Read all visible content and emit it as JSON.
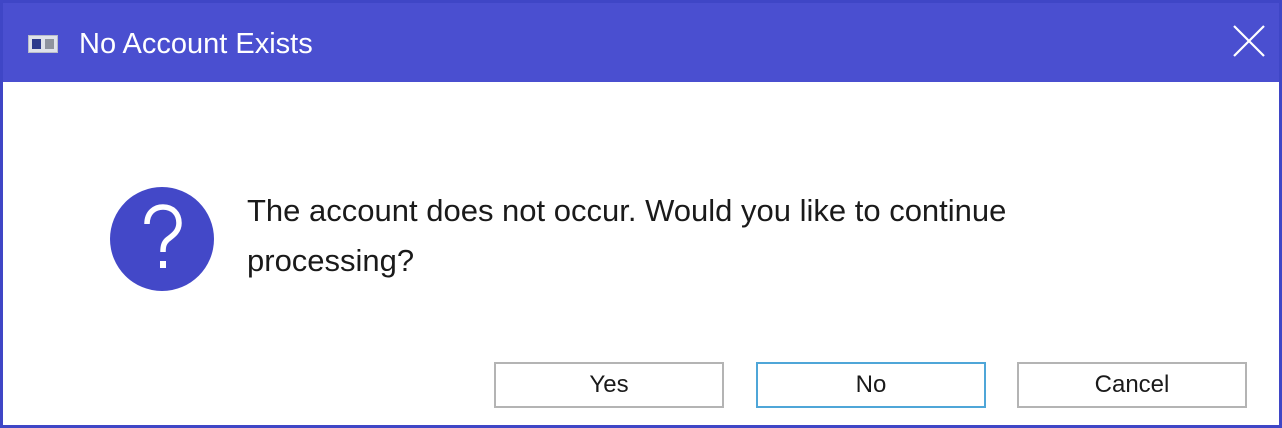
{
  "window": {
    "title": "No Account Exists",
    "accent_color": "#4a4fd0"
  },
  "icons": {
    "app": "app-window-icon",
    "close": "close-icon",
    "message": "question-icon"
  },
  "message": {
    "text": "The account does not occur. Would you like to continue processing?"
  },
  "buttons": {
    "yes": "Yes",
    "no": "No",
    "cancel": "Cancel",
    "default": "No"
  }
}
